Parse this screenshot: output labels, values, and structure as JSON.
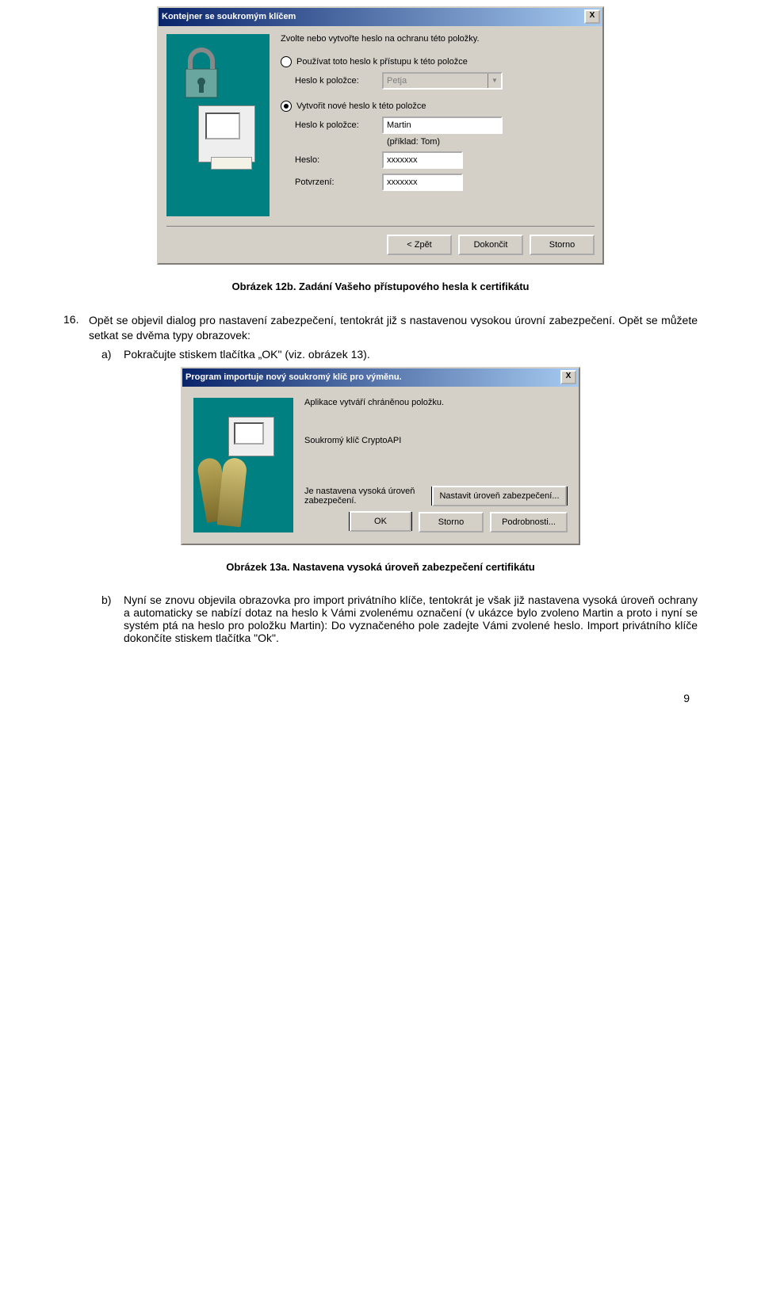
{
  "dialog1": {
    "title": "Kontejner se soukromým klíčem",
    "close": "X",
    "intro": "Zvolte nebo vytvořte heslo na ochranu této položky.",
    "opt_use": "Používat toto heslo k přístupu k této položce",
    "label_heslo_polozce": "Heslo k položce:",
    "combo_value": "Petja",
    "opt_create": "Vytvořit nové heslo k této položce",
    "input_polozka": "Martin",
    "hint": "(příklad: Tom)",
    "label_heslo": "Heslo:",
    "value_heslo": "xxxxxxx",
    "label_potvrzeni": "Potvrzení:",
    "value_potvrzeni": "xxxxxxx",
    "btn_back": "< Zpět",
    "btn_finish": "Dokončit",
    "btn_cancel": "Storno"
  },
  "caption1": "Obrázek 12b. Zadání Vašeho přístupového hesla k certifikátu",
  "item16_num": "16.",
  "item16_text": "Opět se objevil dialog pro nastavení zabezpečení, tentokrát již s nastavenou vysokou úrovní zabezpečení. Opět se můžete setkat se dvěma typy obrazovek:",
  "item_a_num": "a)",
  "item_a_text": "Pokračujte stiskem tlačítka „OK\" (viz. obrázek 13).",
  "dialog2": {
    "title": "Program importuje nový soukromý klíč pro výměnu.",
    "close": "X",
    "line1": "Aplikace vytváří chráněnou položku.",
    "line2": "Soukromý klíč CryptoAPI",
    "sec_note": "Je nastavena vysoká úroveň zabezpečení.",
    "btn_set": "Nastavit úroveň zabezpečení...",
    "btn_ok": "OK",
    "btn_cancel": "Storno",
    "btn_details": "Podrobnosti..."
  },
  "caption2": "Obrázek 13a. Nastavena vysoká úroveň zabezpečení certifikátu",
  "item_b_num": "b)",
  "item_b_text": "Nyní se znovu objevila obrazovka pro import privátního klíče, tentokrát je však již nastavena vysoká úroveň ochrany a automaticky se nabízí dotaz na heslo k Vámi zvolenému označení (v ukázce bylo zvoleno Martin a proto i nyní se systém ptá na heslo pro položku Martin): Do vyznačeného pole zadejte Vámi zvolené heslo. Import privátního klíče dokončíte stiskem tlačítka \"Ok\".",
  "page_number": "9"
}
